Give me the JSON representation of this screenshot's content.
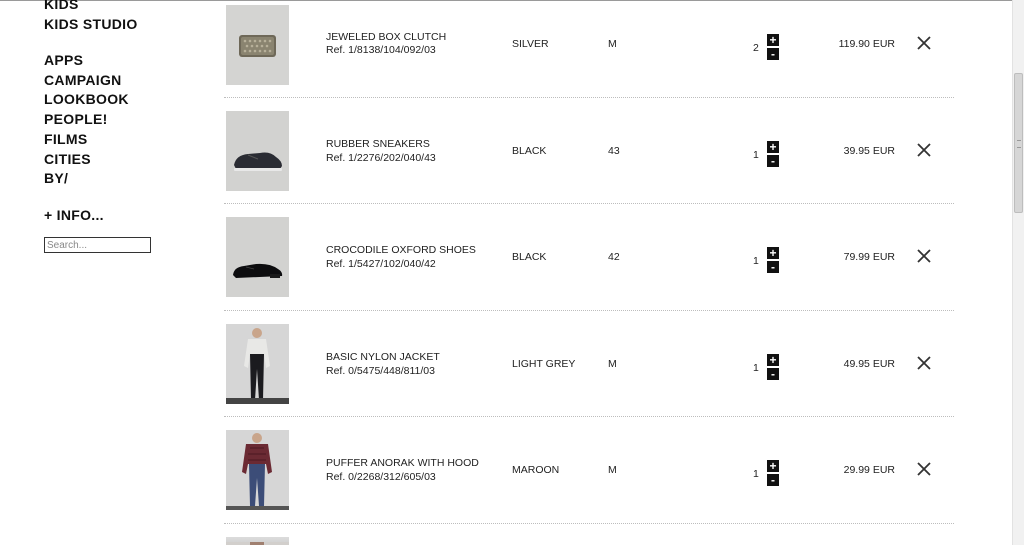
{
  "sidebar": {
    "group1": [
      "KIDS",
      "KIDS STUDIO"
    ],
    "group2": [
      "APPS",
      "CAMPAIGN",
      "LOOKBOOK",
      "PEOPLE!",
      "FILMS",
      "CITIES",
      "BY/"
    ],
    "info": "+ INFO...",
    "search_placeholder": "Search..."
  },
  "cart": {
    "plus_symbol": "+",
    "minus_symbol": "-",
    "items": [
      {
        "name": "JEWELED BOX CLUTCH",
        "ref": "Ref. 1/8138/104/092/03",
        "color": "SILVER",
        "size": "M",
        "qty": "2",
        "price": "119.90 EUR",
        "icon": "clutch-image"
      },
      {
        "name": "RUBBER SNEAKERS",
        "ref": "Ref. 1/2276/202/040/43",
        "color": "BLACK",
        "size": "43",
        "qty": "1",
        "price": "39.95 EUR",
        "icon": "sneaker-image"
      },
      {
        "name": "CROCODILE OXFORD SHOES",
        "ref": "Ref. 1/5427/102/040/42",
        "color": "BLACK",
        "size": "42",
        "qty": "1",
        "price": "79.99 EUR",
        "icon": "oxford-shoe-image"
      },
      {
        "name": "BASIC NYLON JACKET",
        "ref": "Ref. 0/5475/448/811/03",
        "color": "LIGHT GREY",
        "size": "M",
        "qty": "1",
        "price": "49.95 EUR",
        "icon": "jacket-model-image"
      },
      {
        "name": "PUFFER ANORAK WITH HOOD",
        "ref": "Ref. 0/2268/312/605/03",
        "color": "MAROON",
        "size": "M",
        "qty": "1",
        "price": "29.99 EUR",
        "icon": "anorak-model-image"
      }
    ]
  }
}
